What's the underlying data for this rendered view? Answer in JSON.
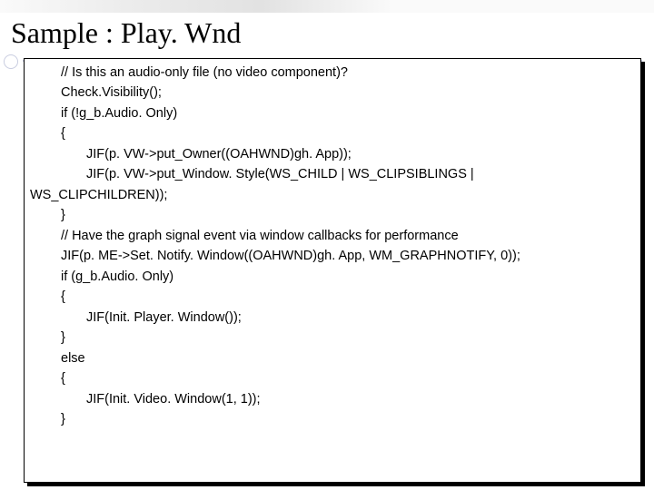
{
  "title": "Sample : Play. Wnd",
  "code": {
    "l0": "// Is this an audio-only file (no video component)?",
    "l1": "Check.Visibility();",
    "l2": "if (!g_b.Audio. Only)",
    "l3": "{",
    "l4": "JIF(p. VW->put_Owner((OAHWND)gh. App));",
    "l5a": "JIF(p. VW->put_Window. Style(WS_CHILD | WS_CLIPSIBLINGS |",
    "l5b": "WS_CLIPCHILDREN));",
    "l6": "}",
    "l7": "// Have the graph signal event via window callbacks for performance",
    "l8": "JIF(p. ME->Set. Notify. Window((OAHWND)gh. App, WM_GRAPHNOTIFY, 0));",
    "l9": "if (g_b.Audio. Only)",
    "l10": "{",
    "l11": "JIF(Init. Player. Window());",
    "l12": "}",
    "l13": "else",
    "l14": "{",
    "l15": "JIF(Init. Video. Window(1, 1));",
    "l16": "}"
  }
}
